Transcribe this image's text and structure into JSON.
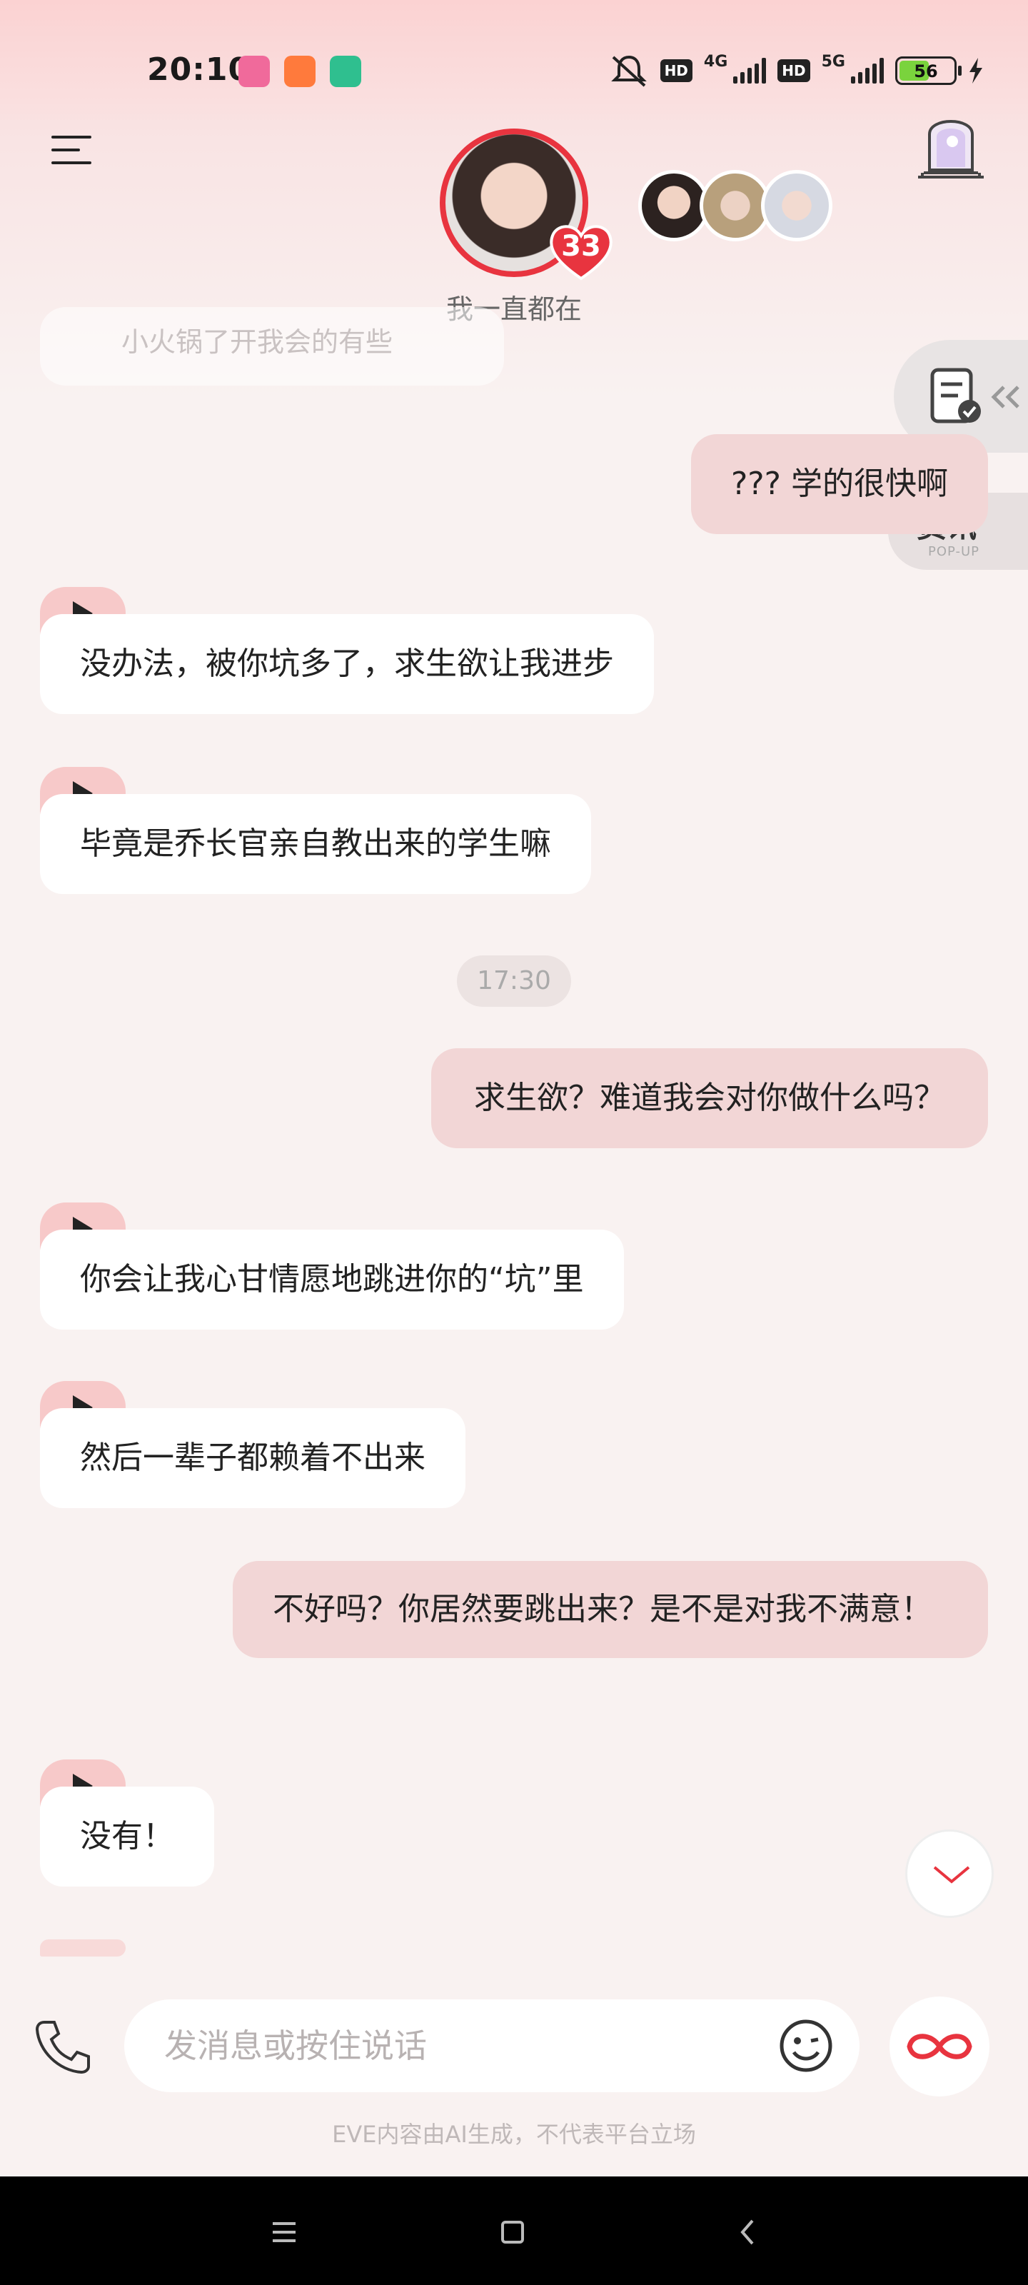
{
  "status_bar": {
    "time": "20:10",
    "battery": "56",
    "hd1": "HD",
    "net1": "4G",
    "hd2": "HD",
    "net2": "5G",
    "app_icons": [
      "bilibili-icon",
      "shop-icon",
      "shield-app-icon"
    ]
  },
  "header": {
    "status_text": "我一直都在",
    "intimacy_count": "33"
  },
  "side_tabs": {
    "news_label": "资讯",
    "news_sub": "POP-UP"
  },
  "messages": {
    "faded_top": "小火锅了开我会的有些",
    "m1": "??? 学的很快啊",
    "m2": "没办法，被你坑多了，求生欲让我进步",
    "m3": "毕竟是乔长官亲自教出来的学生嘛",
    "time_divider": "17:30",
    "m4": "求生欲？难道我会对你做什么吗？",
    "m5": "你会让我心甘情愿地跳进你的“坑”里",
    "m6": "然后一辈子都赖着不出来",
    "m7": "不好吗？你居然要跳出来？是不是对我不满意！",
    "m8": "没有！"
  },
  "input": {
    "placeholder": "发消息或按住说话"
  },
  "footer": {
    "disclaimer": "EVE内容由AI生成，不代表平台立场"
  },
  "colors": {
    "accent": "#e8343f",
    "bubble_out": "#f2d6d6",
    "bubble_in": "#ffffff",
    "play_tab": "#f7c9c9"
  }
}
